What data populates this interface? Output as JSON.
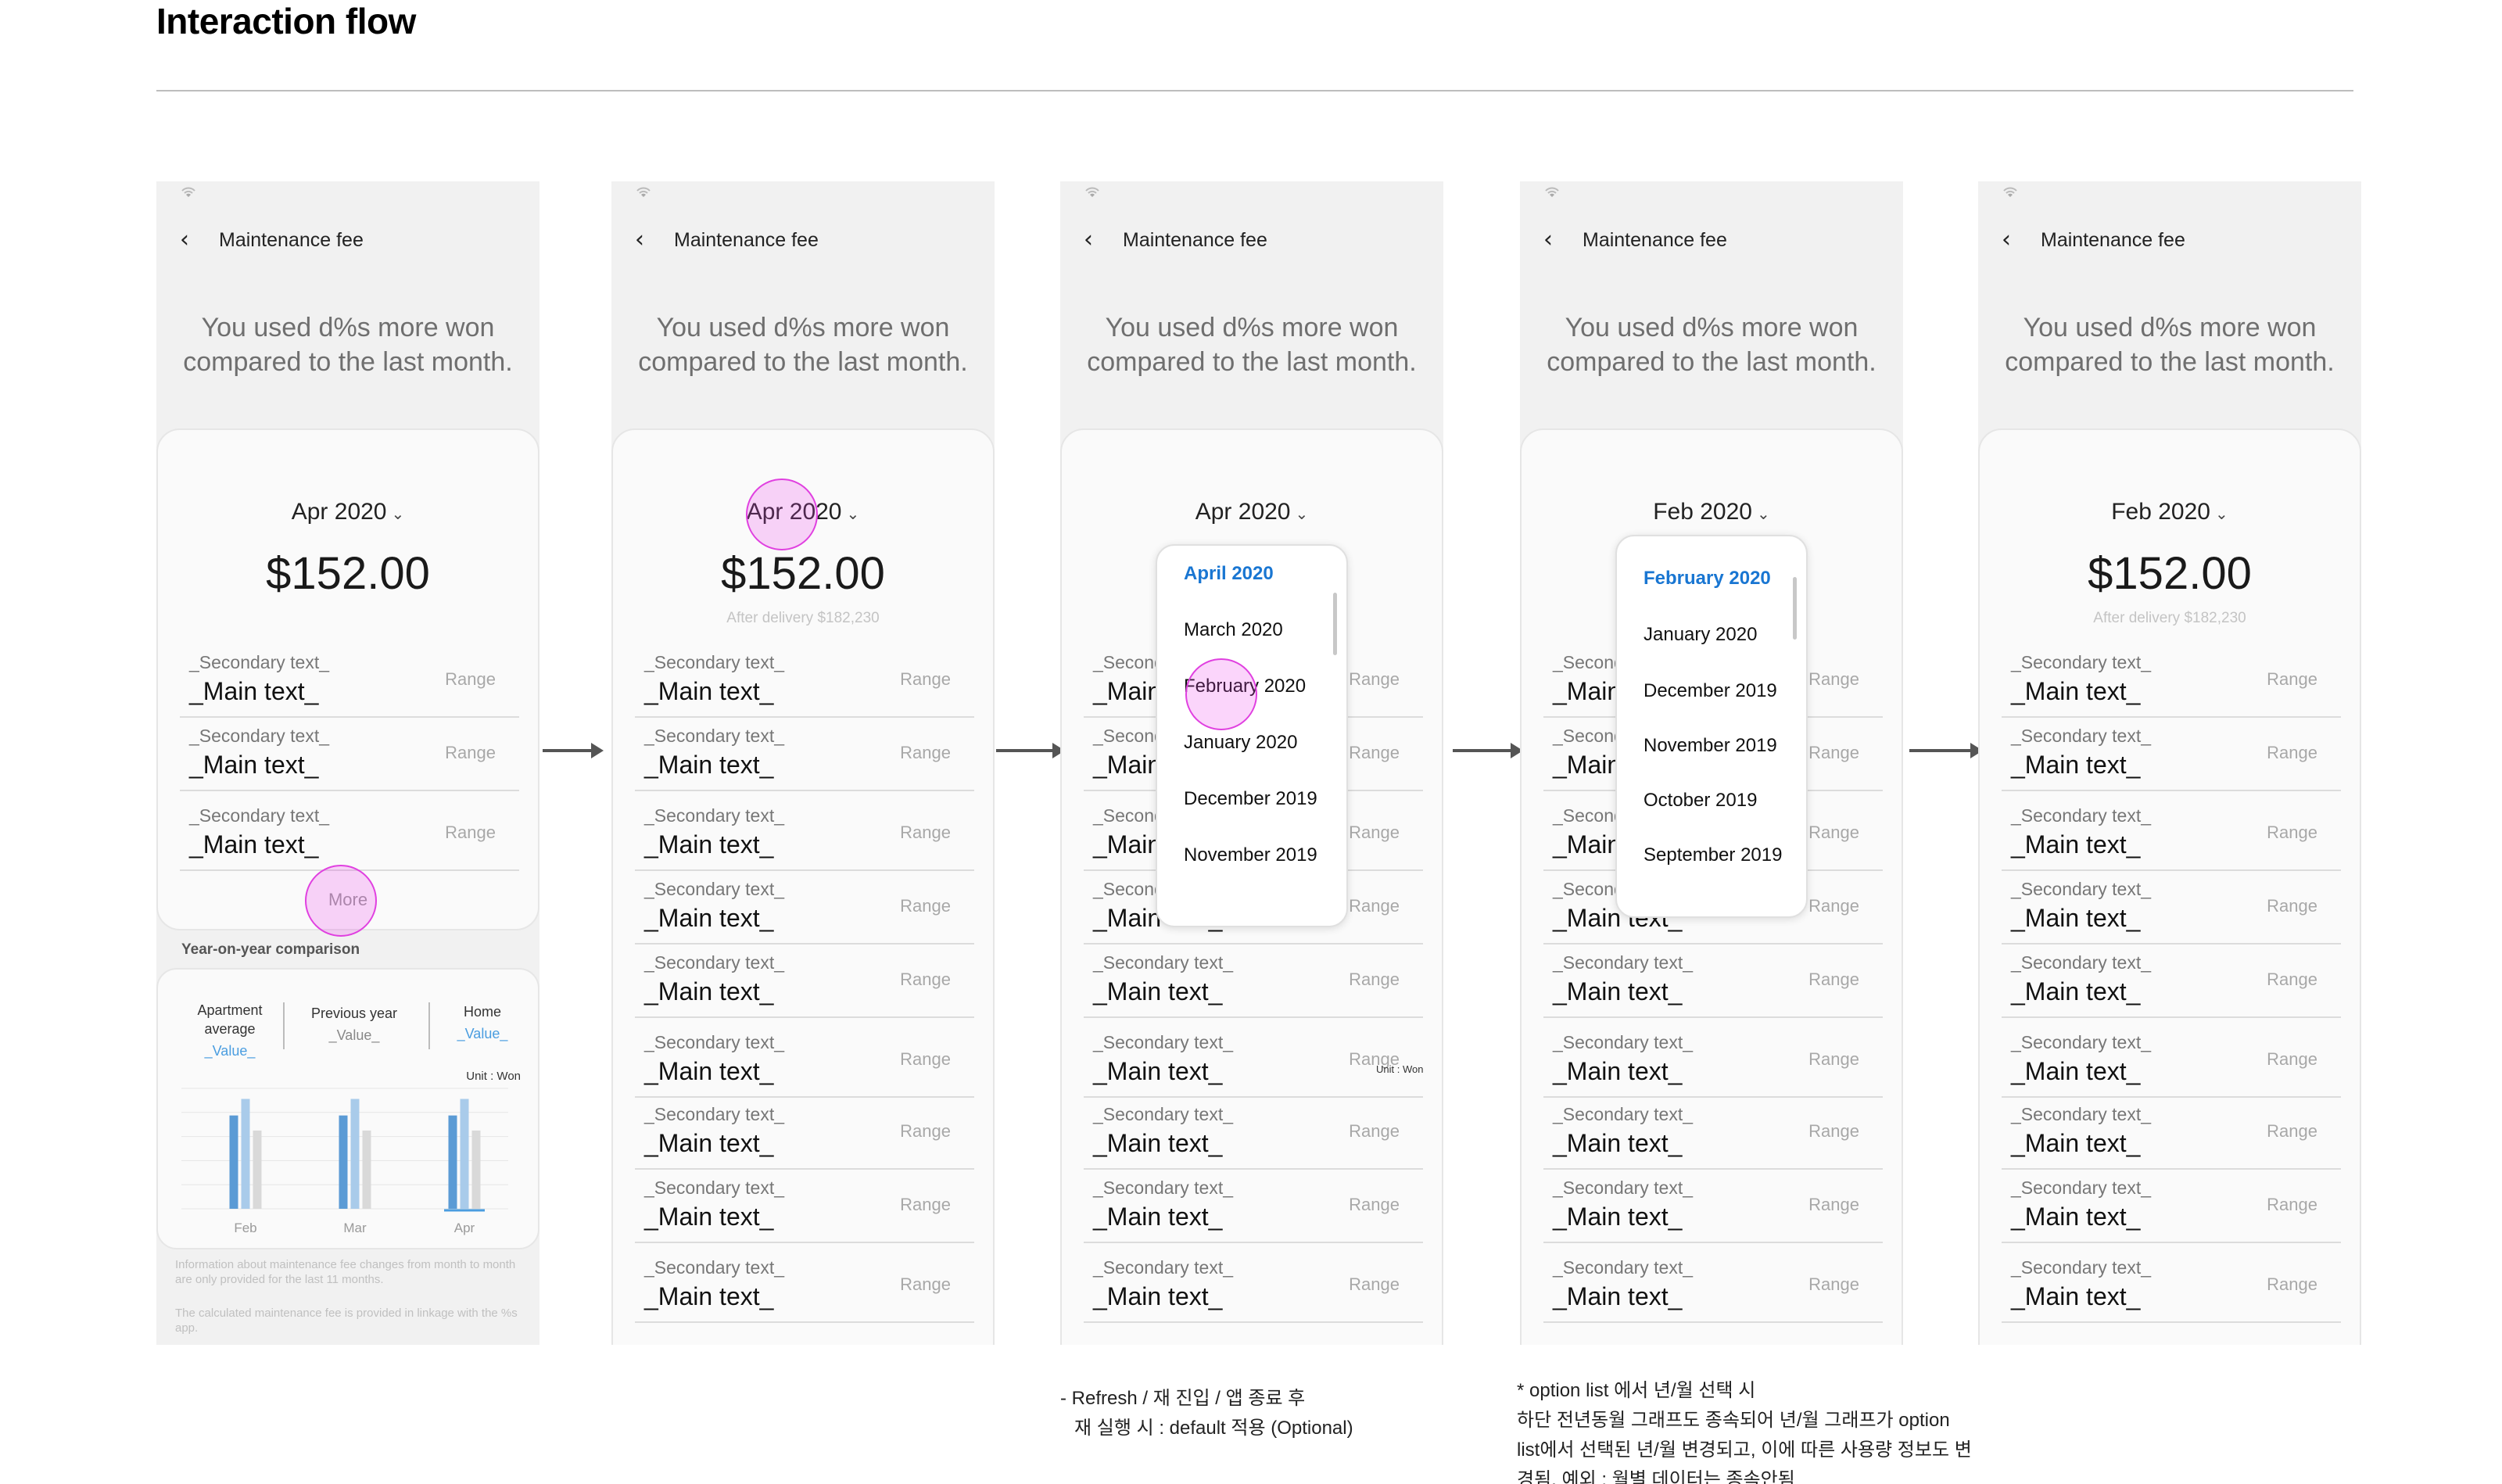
{
  "page": {
    "title": "Interaction flow"
  },
  "screens": [
    {
      "header_title": "Maintenance fee",
      "summary_line1": "You used d%s more won",
      "summary_line2": "compared to the last month.",
      "month": "Apr 2020",
      "amount": "$152.00"
    },
    {
      "header_title": "Maintenance fee",
      "summary_line1": "You used d%s more won",
      "summary_line2": "compared to the last month.",
      "month": "Apr 2020",
      "amount": "$152.00",
      "after_delivery": "After delivery $182,230"
    },
    {
      "header_title": "Maintenance fee",
      "summary_line1": "You used d%s more won",
      "summary_line2": "compared to the last month.",
      "month": "Apr 2020"
    },
    {
      "header_title": "Maintenance fee",
      "summary_line1": "You used d%s more won",
      "summary_line2": "compared to the last month.",
      "month": "Feb 2020"
    },
    {
      "header_title": "Maintenance fee",
      "summary_line1": "You used d%s more won",
      "summary_line2": "compared to the last month.",
      "month": "Feb 2020",
      "amount": "$152.00",
      "after_delivery": "After delivery $182,230"
    }
  ],
  "list_item": {
    "secondary": "_Secondary text_",
    "main": "_Main text_",
    "range": "Range"
  },
  "more_label": "More",
  "yoy": {
    "title": "Year-on-year comparison",
    "col1_line1": "Apartment",
    "col1_line2": "average",
    "col1_value": "_Value_",
    "col2": "Previous year",
    "col2_value": "_Value_",
    "col3": "Home",
    "col3_value": "_Value_",
    "unit": "Unit : Won",
    "note1": "Information about maintenance fee changes from month to month are only provided for the last 11 months.",
    "note2": "The calculated maintenance fee is provided in linkage with the %s app."
  },
  "chart_data": {
    "type": "bar",
    "categories": [
      "Feb",
      "Mar",
      "Apr"
    ],
    "series": [
      {
        "values": [
          62,
          62,
          62
        ],
        "color": "#5b9bd5"
      },
      {
        "values": [
          73,
          73,
          73
        ],
        "color": "#a9cbea"
      },
      {
        "values": [
          52,
          52,
          52
        ],
        "color": "#d9d9d9"
      }
    ],
    "ylim": [
      0,
      80
    ],
    "grid": true
  },
  "dropdown1": {
    "options": [
      "April 2020",
      "March 2020",
      "February 2020",
      "January 2020",
      "December 2019",
      "November 2019"
    ],
    "selected": "April 2020"
  },
  "dropdown2": {
    "options": [
      "February 2020",
      "January 2020",
      "December 2019",
      "November 2019",
      "October 2019",
      "September 2019"
    ],
    "selected": "February 2020"
  },
  "unit_small": "Unit : Won",
  "notes": {
    "note_a_line1": "- Refresh / 재 진입 / 앱 종료 후",
    "note_a_line2": "  재 실행 시 : default 적용 (Optional)",
    "note_b_line1": "* option list 에서 년/월 선택 시",
    "note_b_line2": "하단 전년동월 그래프도 종속되어 년/월 그래프가 option",
    "note_b_line3": "list에서 선택된 년/월 변경되고, 이에 따른 사용량 정보도 변",
    "note_b_line4": "경됨. 예외 : 월별 데이터는 종속안됨"
  },
  "icons": {
    "back": "back-chevron-icon",
    "status": "wifi-icon",
    "dropdown": "chevron-down-icon"
  }
}
